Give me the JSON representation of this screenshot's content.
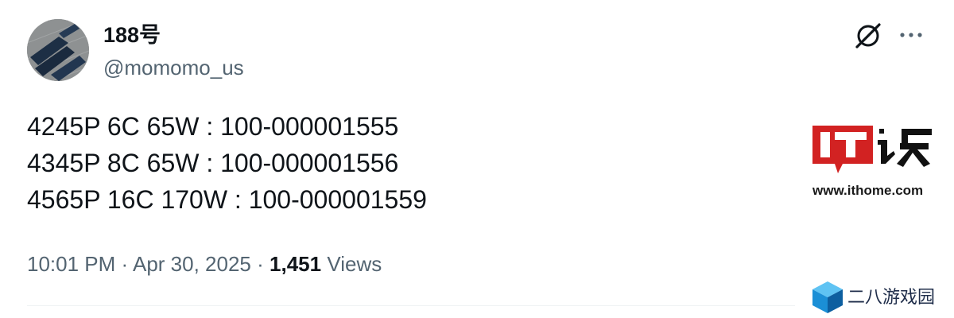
{
  "tweet": {
    "author": {
      "display_name": "188号",
      "handle": "@momomo_us"
    },
    "lines": [
      "4245P 6C 65W : 100-000001555",
      "4345P 8C 65W : 100-000001556",
      "4565P 16C 170W : 100-000001559"
    ],
    "time": "10:01 PM",
    "separator": "·",
    "date": "Apr 30, 2025",
    "views_count": "1,451",
    "views_label": "Views"
  },
  "icons": {
    "grok": "grok-icon",
    "more": "more-icon"
  },
  "watermarks": {
    "ithome": {
      "logo_text": "IT之家",
      "url": "www.ithome.com",
      "color": "#d22222"
    },
    "game_site": {
      "text": "二八游戏园",
      "color": "#1b8fd6"
    }
  },
  "colors": {
    "text_primary": "#0f1419",
    "text_secondary": "#536471",
    "divider": "#eff3f4"
  }
}
